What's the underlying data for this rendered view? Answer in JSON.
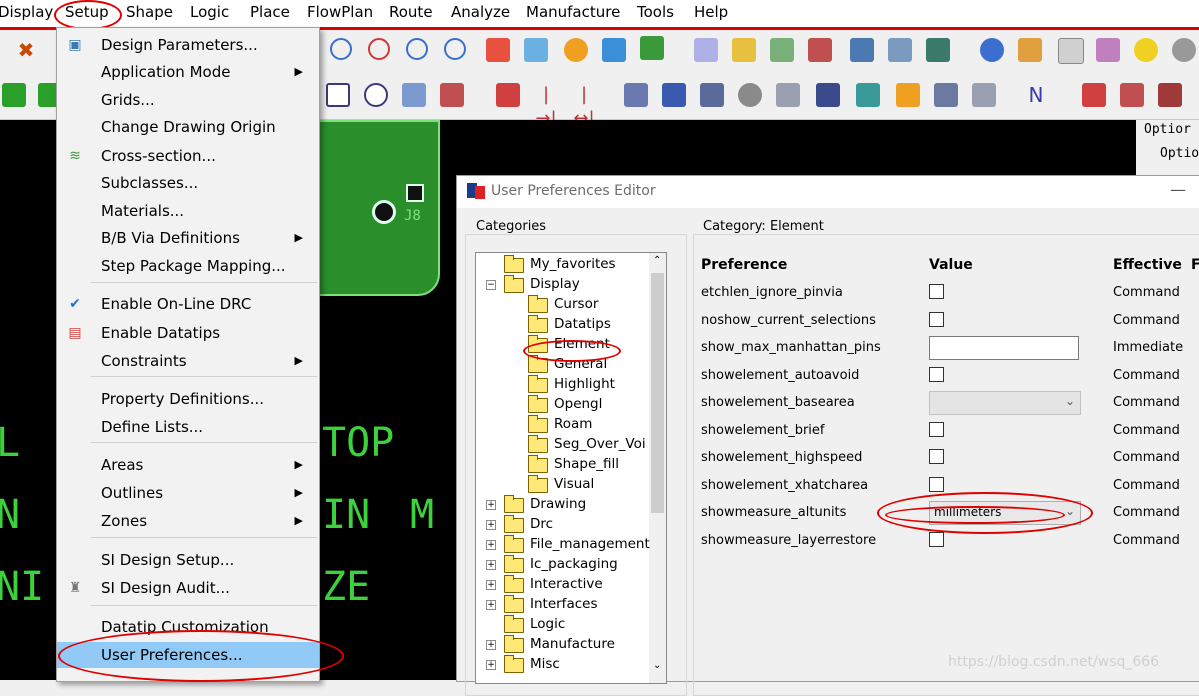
{
  "menubar": {
    "items": [
      "Display",
      "Setup",
      "Shape",
      "Logic",
      "Place",
      "FlowPlan",
      "Route",
      "Analyze",
      "Manufacture",
      "Tools",
      "Help"
    ]
  },
  "setup_menu": {
    "items": [
      {
        "label": "Design Parameters...",
        "icon": "design-parameters-icon"
      },
      {
        "label": "Application Mode",
        "submenu": true
      },
      {
        "label": "Grids..."
      },
      {
        "label": "Change Drawing Origin"
      },
      {
        "label": "Cross-section...",
        "icon": "cross-section-icon"
      },
      {
        "label": "Subclasses..."
      },
      {
        "label": "Materials..."
      },
      {
        "label": "B/B Via Definitions",
        "submenu": true
      },
      {
        "label": "Step Package Mapping..."
      },
      {
        "label": "Enable On-Line DRC",
        "icon": "check-icon"
      },
      {
        "label": "Enable Datatips",
        "icon": "datatips-icon"
      },
      {
        "label": "Constraints",
        "submenu": true
      },
      {
        "label": "Property Definitions..."
      },
      {
        "label": "Define Lists..."
      },
      {
        "label": "Areas",
        "submenu": true
      },
      {
        "label": "Outlines",
        "submenu": true
      },
      {
        "label": "Zones",
        "submenu": true
      },
      {
        "label": "SI Design Setup..."
      },
      {
        "label": "SI Design Audit...",
        "icon": "audit-icon"
      },
      {
        "label": "Datatip Customization"
      },
      {
        "label": "User Preferences...",
        "selected": true
      }
    ]
  },
  "canvas": {
    "labels": [
      "J8",
      "TOP",
      "IN",
      "M",
      "ZE"
    ]
  },
  "right_panel": {
    "tabs": [
      "Optior",
      "Optio"
    ]
  },
  "dialog": {
    "title": "User Preferences Editor",
    "categories_label": "Categories",
    "category_prefix": "Category:",
    "category_name": "Element",
    "tree": [
      {
        "label": "My_favorites",
        "level": 1,
        "pm": ""
      },
      {
        "label": "Display",
        "level": 1,
        "pm": "-"
      },
      {
        "label": "Cursor",
        "level": 2
      },
      {
        "label": "Datatips",
        "level": 2
      },
      {
        "label": "Element",
        "level": 2
      },
      {
        "label": "General",
        "level": 2
      },
      {
        "label": "Highlight",
        "level": 2
      },
      {
        "label": "Opengl",
        "level": 2
      },
      {
        "label": "Roam",
        "level": 2
      },
      {
        "label": "Seg_Over_Voi",
        "level": 2
      },
      {
        "label": "Shape_fill",
        "level": 2
      },
      {
        "label": "Visual",
        "level": 2
      },
      {
        "label": "Drawing",
        "level": 1,
        "pm": "+"
      },
      {
        "label": "Drc",
        "level": 1,
        "pm": "+"
      },
      {
        "label": "File_management",
        "level": 1,
        "pm": "+"
      },
      {
        "label": "Ic_packaging",
        "level": 1,
        "pm": "+"
      },
      {
        "label": "Interactive",
        "level": 1,
        "pm": "+"
      },
      {
        "label": "Interfaces",
        "level": 1,
        "pm": "+"
      },
      {
        "label": "Logic",
        "level": 1,
        "pm": ""
      },
      {
        "label": "Manufacture",
        "level": 1,
        "pm": "+"
      },
      {
        "label": "Misc",
        "level": 1,
        "pm": "+"
      }
    ],
    "headers": {
      "preference": "Preference",
      "value": "Value",
      "effective": "Effective",
      "f": "F"
    },
    "prefs": [
      {
        "name": "etchlen_ignore_pinvia",
        "control": "checkbox",
        "effective": "Command"
      },
      {
        "name": "noshow_current_selections",
        "control": "checkbox",
        "effective": "Command"
      },
      {
        "name": "show_max_manhattan_pins",
        "control": "text",
        "effective": "Immediate"
      },
      {
        "name": "showelement_autoavoid",
        "control": "checkbox",
        "effective": "Command"
      },
      {
        "name": "showelement_basearea",
        "control": "combo",
        "value": "",
        "effective": "Command"
      },
      {
        "name": "showelement_brief",
        "control": "checkbox",
        "effective": "Command"
      },
      {
        "name": "showelement_highspeed",
        "control": "checkbox",
        "effective": "Command"
      },
      {
        "name": "showelement_xhatcharea",
        "control": "checkbox",
        "effective": "Command"
      },
      {
        "name": "showmeasure_altunits",
        "control": "combo",
        "value": "millimeters",
        "effective": "Command"
      },
      {
        "name": "showmeasure_layerrestore",
        "control": "checkbox",
        "effective": "Command"
      }
    ]
  },
  "watermark": "https://blog.csdn.net/wsq_666",
  "colors": {
    "highlight_red": "#e00000",
    "selection_blue": "#91c9f7",
    "pcb_green": "#2a8f2a",
    "glyph_green": "#3dd23d"
  }
}
